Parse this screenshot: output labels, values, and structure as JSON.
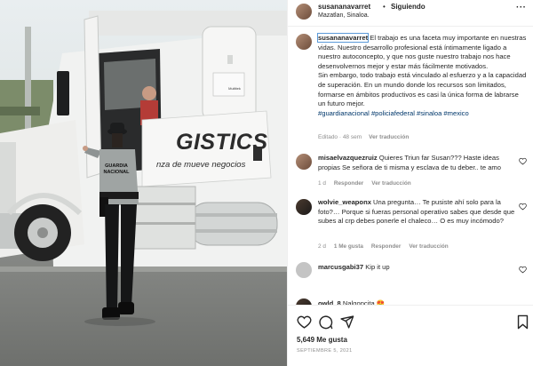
{
  "photo": {
    "truck_logo": "GISTICS",
    "truck_slogan": "nza de mueve negocios",
    "vest_text": "GUARDIA NACIONAL",
    "sticker_text": "Multitek"
  },
  "header": {
    "username": "susananavarret",
    "separator": "•",
    "follow_status": "Siguiendo",
    "location": "Mazatlan, Sinaloa.",
    "more_icon": "more-options-icon"
  },
  "caption": {
    "username": "susananavarret",
    "text": " El trabajo es una faceta muy importante en nuestras vidas. Nuestro desarrollo profesional está íntimamente ligado a nuestro autoconcepto, y que nos guste nuestro trabajo nos hace desenvolvernos mejor y estar más fácilmente motivados.",
    "text2": "Sin embargo, todo trabajo está vinculado al esfuerzo y a la capacidad de superación. En un mundo donde los recursos son limitados, formarse en ámbitos productivos es casi la única forma de labrarse un futuro mejor.",
    "hashtags": "#guardianacional #policiafederal #sinaloa #mexico",
    "edited": "Editado · 48 sem",
    "see_translation": "Ver traducción"
  },
  "comments": [
    {
      "username": "misaelvazquezruiz",
      "text": " Quieres Triun far Susan??? Haste ideas propias Se señora de ti misma y esclava de tu deber.. te amo",
      "time": "1 d",
      "reply": "Responder",
      "likes": "",
      "translate": "Ver traducción"
    },
    {
      "username": "wolvie_weaponx",
      "text": " Una pregunta… Te pusiste ahí solo para la foto?… Porque si fueras personal operativo sabes que desde que subes al crp debes ponerle el chaleco… O es muy incómodo?",
      "time": "2 d",
      "reply": "Responder",
      "likes": "1 Me gusta",
      "translate": "Ver traducción"
    },
    {
      "username": "marcusgabi37",
      "text": " Kip it up",
      "time": "",
      "reply": "",
      "likes": "",
      "translate": ""
    },
    {
      "username": "owld_8",
      "text": " Nalgoncita 😍",
      "time": "",
      "reply": "",
      "likes": "",
      "translate": ""
    }
  ],
  "actions": {
    "likes": "5,649 Me gusta",
    "date": "SEPTIEMBRE 5, 2021",
    "icons": [
      "heart-icon",
      "comment-icon",
      "share-icon",
      "bookmark-icon"
    ]
  },
  "colors": {
    "text": "#262626",
    "secondary": "#8e8e8e",
    "link": "#00376b",
    "border": "#efefef"
  }
}
